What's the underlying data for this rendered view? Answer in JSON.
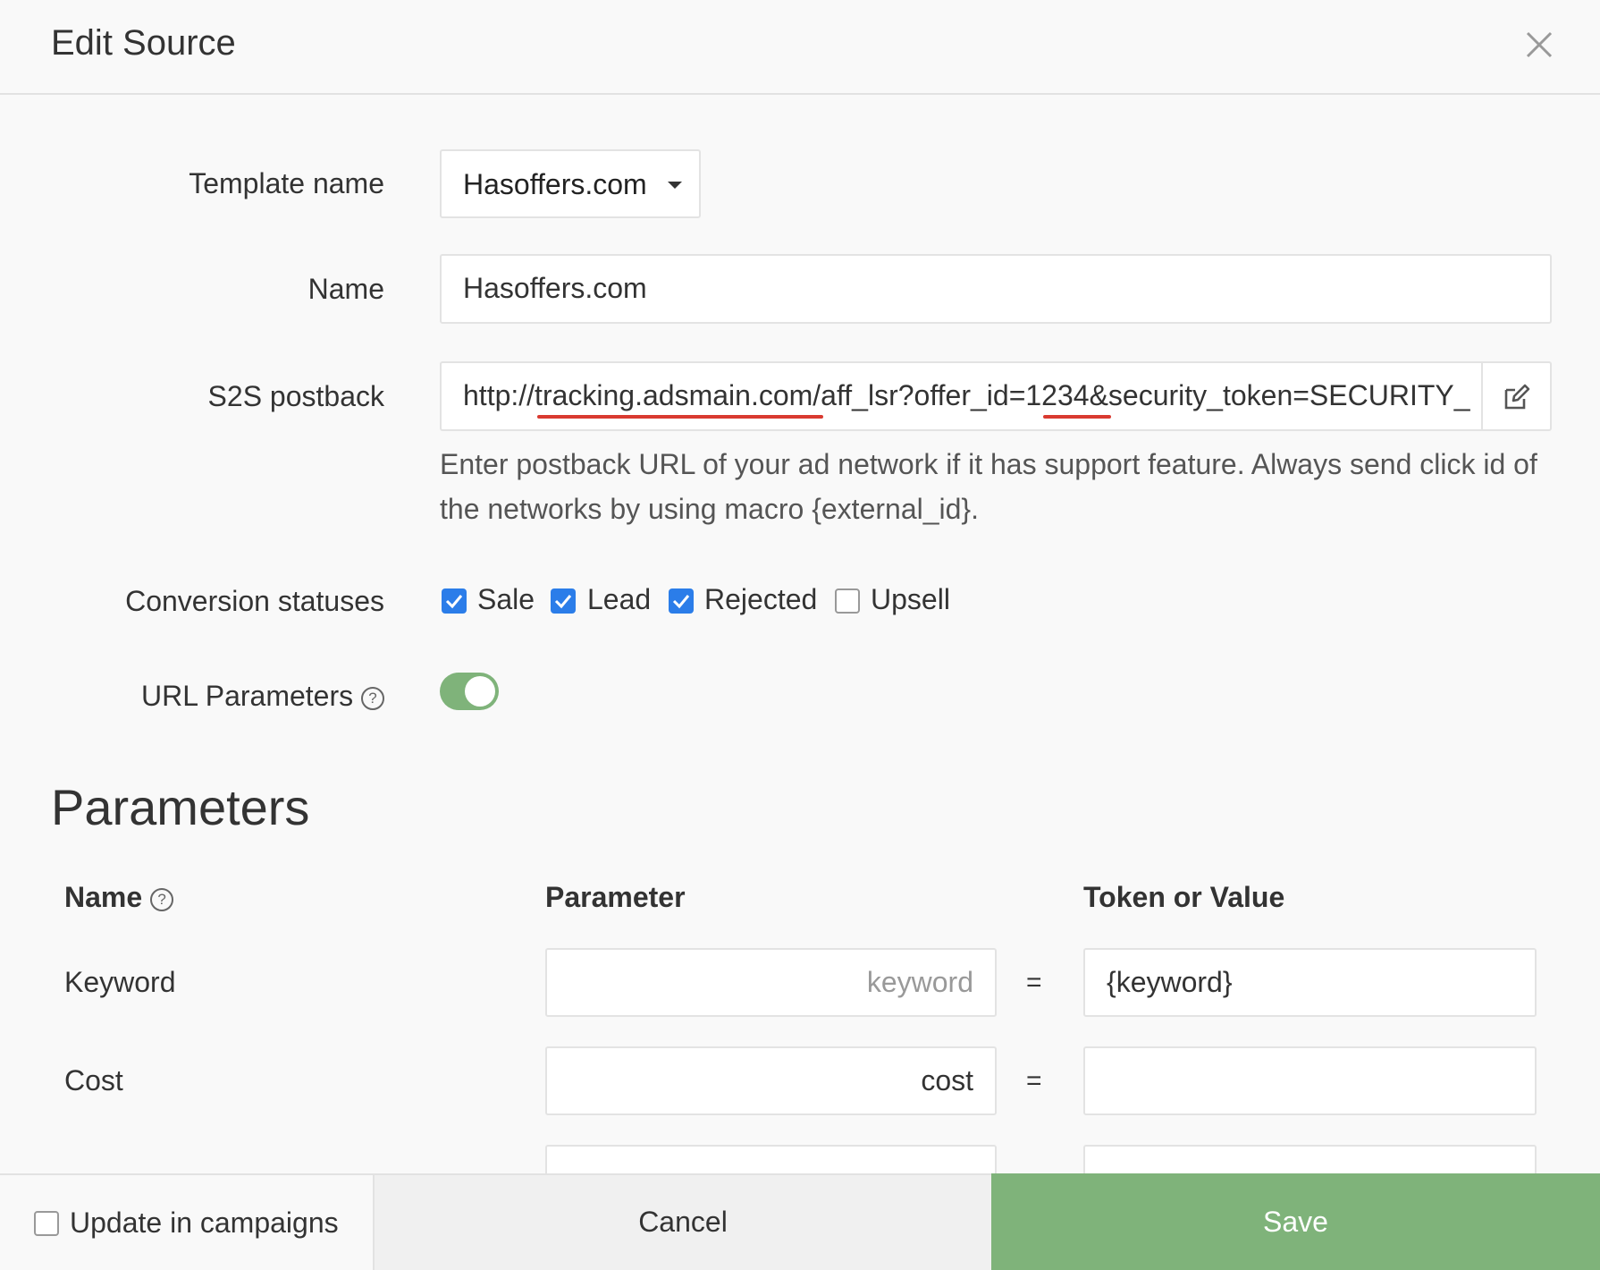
{
  "header": {
    "title": "Edit Source"
  },
  "form": {
    "template_label": "Template name",
    "template_value": "Hasoffers.com",
    "name_label": "Name",
    "name_value": "Hasoffers.com",
    "postback_label": "S2S postback",
    "postback_value": "http://tracking.adsmain.com/aff_lsr?offer_id=1234&security_token=SECURITY_",
    "postback_help": "Enter postback URL of your ad network if it has support feature. Always send click id of the networks by using macro {external_id}.",
    "statuses_label": "Conversion statuses",
    "statuses": [
      {
        "label": "Sale",
        "checked": true
      },
      {
        "label": "Lead",
        "checked": true
      },
      {
        "label": "Rejected",
        "checked": true
      },
      {
        "label": "Upsell",
        "checked": false
      }
    ],
    "url_params_label": "URL Parameters",
    "url_params_enabled": true,
    "help_glyph": "?"
  },
  "parameters": {
    "title": "Parameters",
    "columns": {
      "name": "Name",
      "parameter": "Parameter",
      "token": "Token or Value"
    },
    "equals": "=",
    "rows": [
      {
        "name": "Keyword",
        "parameter_placeholder": "keyword",
        "parameter_value": "",
        "token": "{keyword}"
      },
      {
        "name": "Cost",
        "parameter_placeholder": "",
        "parameter_value": "cost",
        "token": ""
      }
    ]
  },
  "footer": {
    "update_label": "Update in campaigns",
    "cancel_label": "Cancel",
    "save_label": "Save"
  },
  "colors": {
    "accent_green": "#7fb37a",
    "checkbox_blue": "#2b7de9",
    "annotation_red": "#d93a30"
  },
  "icons": {
    "close": "close-icon",
    "edit": "edit-icon",
    "help": "help-icon",
    "caret": "caret-down-icon"
  }
}
